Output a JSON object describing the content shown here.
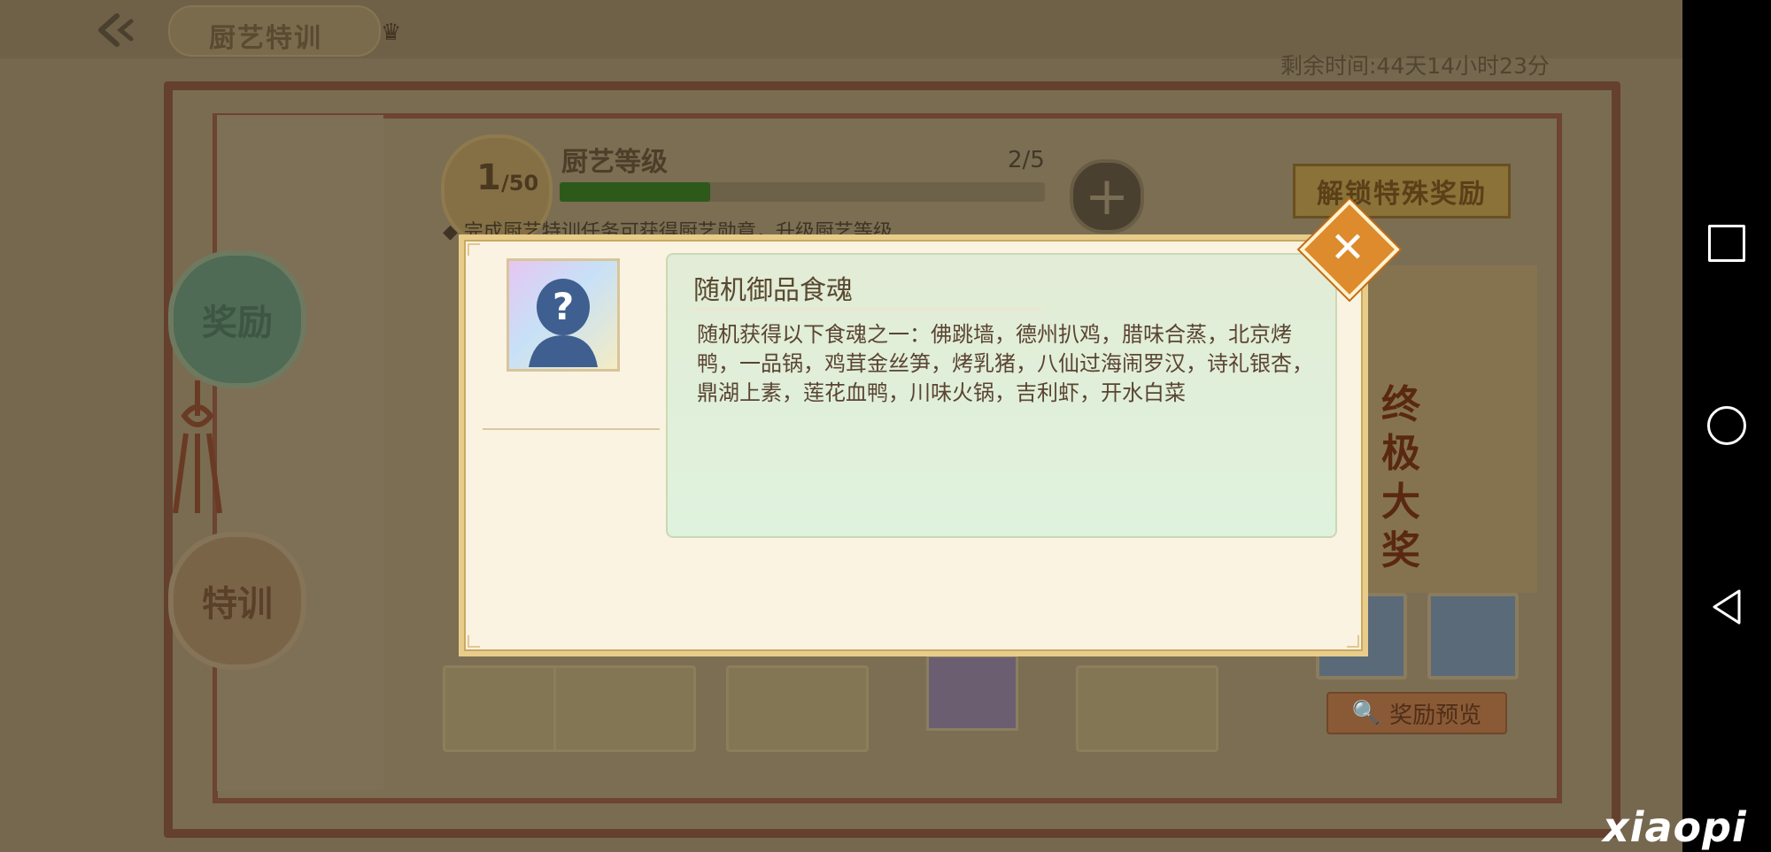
{
  "header": {
    "title": "厨艺特训",
    "remaining_time": "剩余时间:44天14小时23分"
  },
  "side_tabs": [
    {
      "label": "奖励"
    },
    {
      "label": "特训"
    }
  ],
  "level": {
    "current": "1",
    "max": "/50",
    "label": "厨艺等级",
    "count": "2/5",
    "progress_percent": 31,
    "description": "◆ 完成厨艺特训任务可获得厨艺勋章，升级厨艺等级"
  },
  "right_panel": {
    "unlock_label": "解锁特殊奖励",
    "big_prize_text": "终极大奖",
    "preview_label": "奖励预览"
  },
  "popup": {
    "title": "随机御品食魂",
    "description": "随机获得以下食魂之一：佛跳墙，德州扒鸡，腊味合蒸，北京烤鸭，一品锅，鸡茸金丝笋，烤乳猪，八仙过海闹罗汉，诗礼银杏，鼎湖上素，莲花血鸭，川味火锅，吉利虾，开水白菜",
    "close_icon": "close-icon",
    "item_icon": "mystery-person-icon"
  },
  "watermark": "xiaopi",
  "colors": {
    "accent_orange": "#dd8b2c",
    "popup_bg": "#fbf3e1",
    "panel_green": "#e2ecd6"
  }
}
